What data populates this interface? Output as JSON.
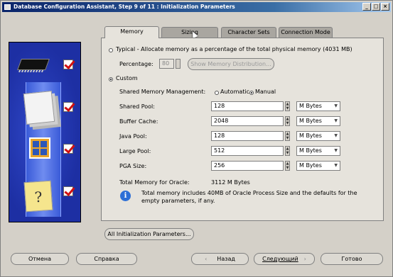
{
  "window": {
    "title": "Database Configuration Assistant, Step 9 of 11 : Initialization Parameters",
    "min_label": "_",
    "max_label": "□",
    "close_label": "×"
  },
  "tabs": [
    {
      "label": "Memory",
      "active": true
    },
    {
      "label": "Sizing",
      "active": false
    },
    {
      "label": "Character Sets",
      "active": false
    },
    {
      "label": "Connection Mode",
      "active": false
    }
  ],
  "memory": {
    "typical_label": "Typical - Allocate memory as a percentage of the total physical memory (4031 MB)",
    "typical_selected": false,
    "percentage_label": "Percentage:",
    "percentage_value": "80",
    "show_distribution_label": "Show Memory Distribution...",
    "custom_label": "Custom",
    "custom_selected": true,
    "smm_label": "Shared Memory Management:",
    "automatic_label": "Automatic",
    "manual_label": "Manual",
    "manual_selected": true,
    "rows": [
      {
        "label": "Shared Pool:",
        "value": "128",
        "unit": "M Bytes"
      },
      {
        "label": "Buffer Cache:",
        "value": "2048",
        "unit": "M Bytes"
      },
      {
        "label": "Java Pool:",
        "value": "128",
        "unit": "M Bytes"
      },
      {
        "label": "Large Pool:",
        "value": "512",
        "unit": "M Bytes"
      },
      {
        "label": "PGA Size:",
        "value": "256",
        "unit": "M Bytes"
      }
    ],
    "total_label": "Total Memory for Oracle:",
    "total_value": "3112 M Bytes",
    "info_text": "Total memory includes 40MB of Oracle Process Size and the defaults for the empty parameters, if any."
  },
  "all_params_label": "All Initialization Parameters...",
  "footer": {
    "cancel": "Отмена",
    "help": "Справка",
    "back": "Назад",
    "next": "Следующий",
    "finish": "Готово",
    "back_arrow": "‹",
    "next_arrow": "›"
  },
  "icons": {
    "info": "i",
    "spin_up": "▲",
    "spin_down": "▼",
    "combo_arrow": "▼",
    "question": "?"
  }
}
